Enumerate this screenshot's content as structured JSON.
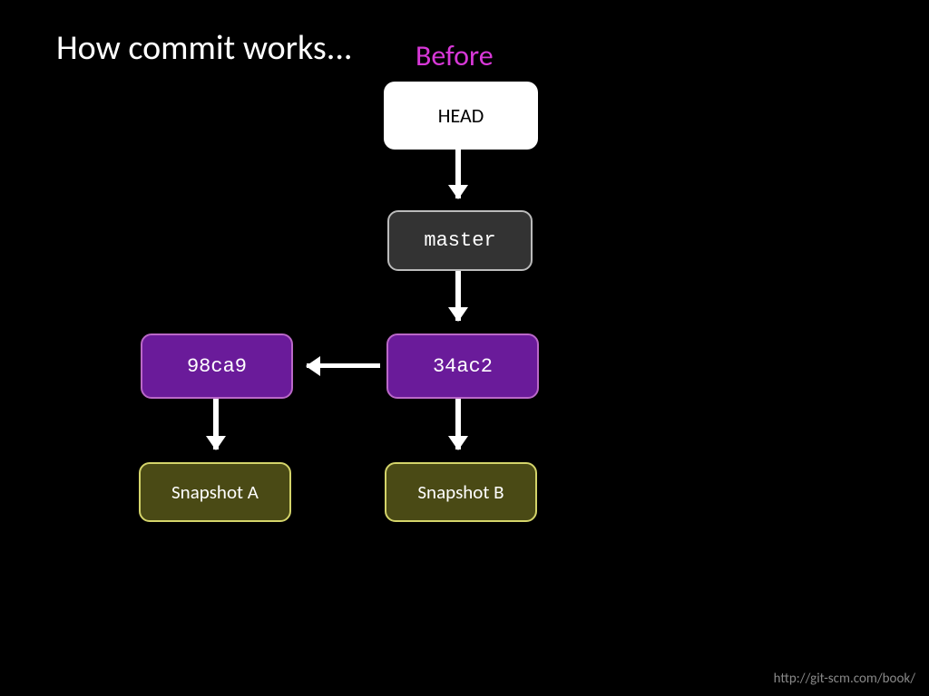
{
  "title": "How commit works...",
  "subtitle": "Before",
  "nodes": {
    "head": "HEAD",
    "master": "master",
    "commit1": "98ca9",
    "commit2": "34ac2",
    "snapshotA": "Snapshot A",
    "snapshotB": "Snapshot B"
  },
  "footer": "http://git-scm.com/book/"
}
